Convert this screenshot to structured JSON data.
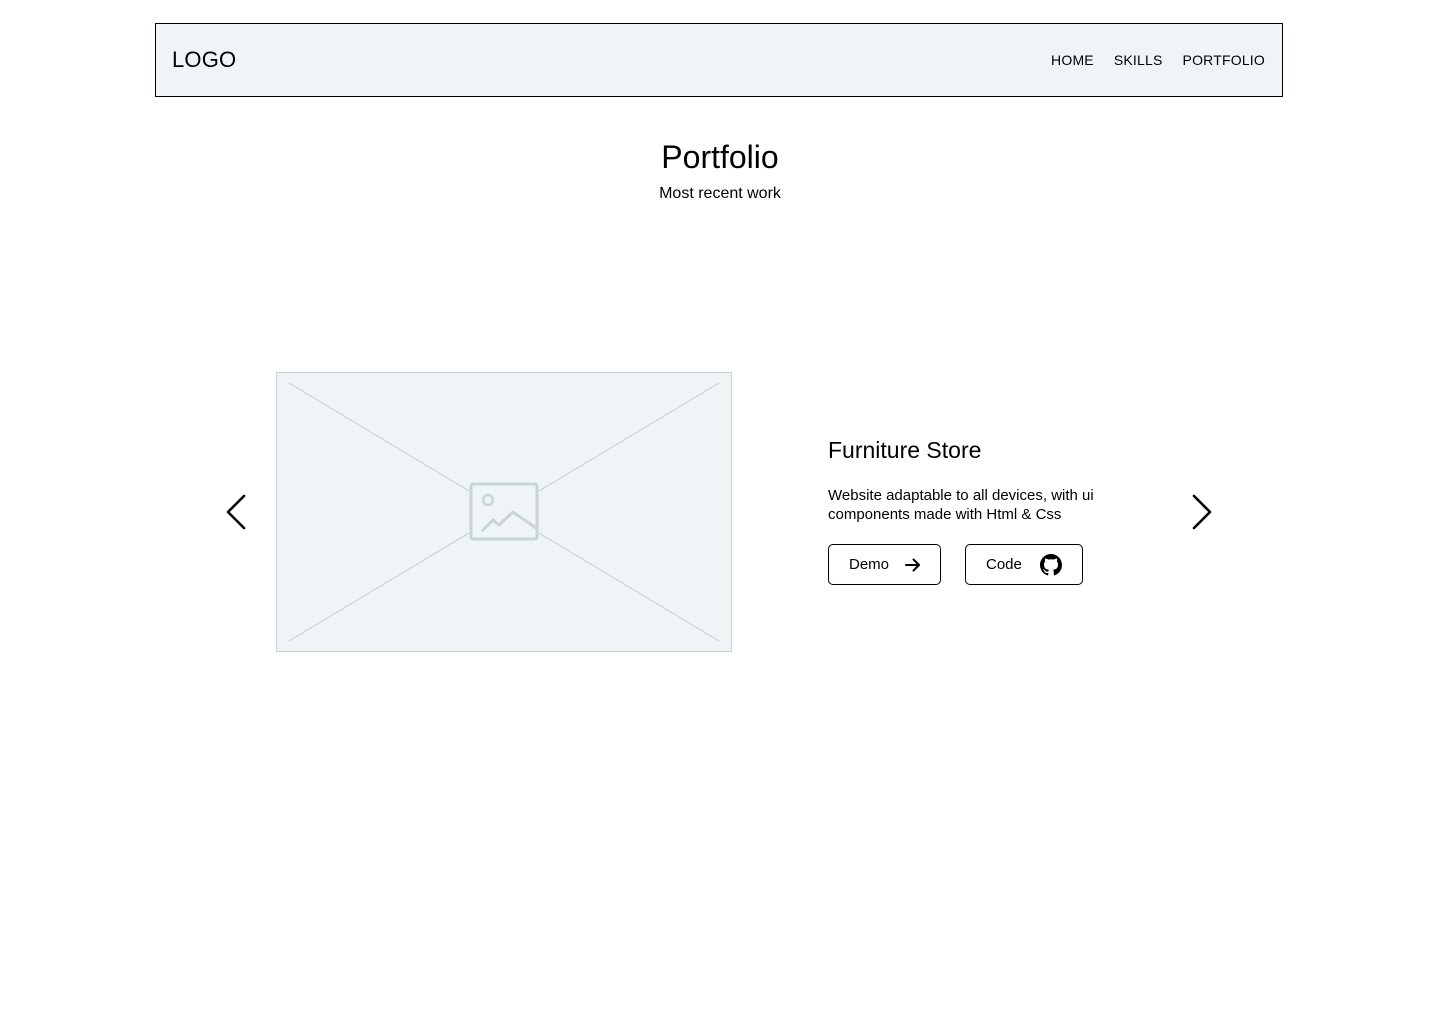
{
  "header": {
    "logo": "LOGO",
    "nav": [
      {
        "label": "HOME"
      },
      {
        "label": "SKILLS"
      },
      {
        "label": "PORTFOLIO"
      }
    ]
  },
  "hero": {
    "title": "Portfolio",
    "subtitle": "Most recent work"
  },
  "carousel": {
    "prev_icon": "chevron-left-icon",
    "next_icon": "chevron-right-icon",
    "image_icon": "image-placeholder-icon",
    "project": {
      "title": "Furniture Store",
      "description": "Website adaptable to all  devices, with ui components made with Html & Css",
      "demo_label": "Demo",
      "demo_icon": "arrow-right-icon",
      "code_label": "Code",
      "code_icon": "github-icon"
    }
  },
  "colors": {
    "navbar_bg": "#eff4f7",
    "placeholder_bg": "#eff4f7",
    "placeholder_stroke": "#c8d4da",
    "text": "#000000"
  }
}
